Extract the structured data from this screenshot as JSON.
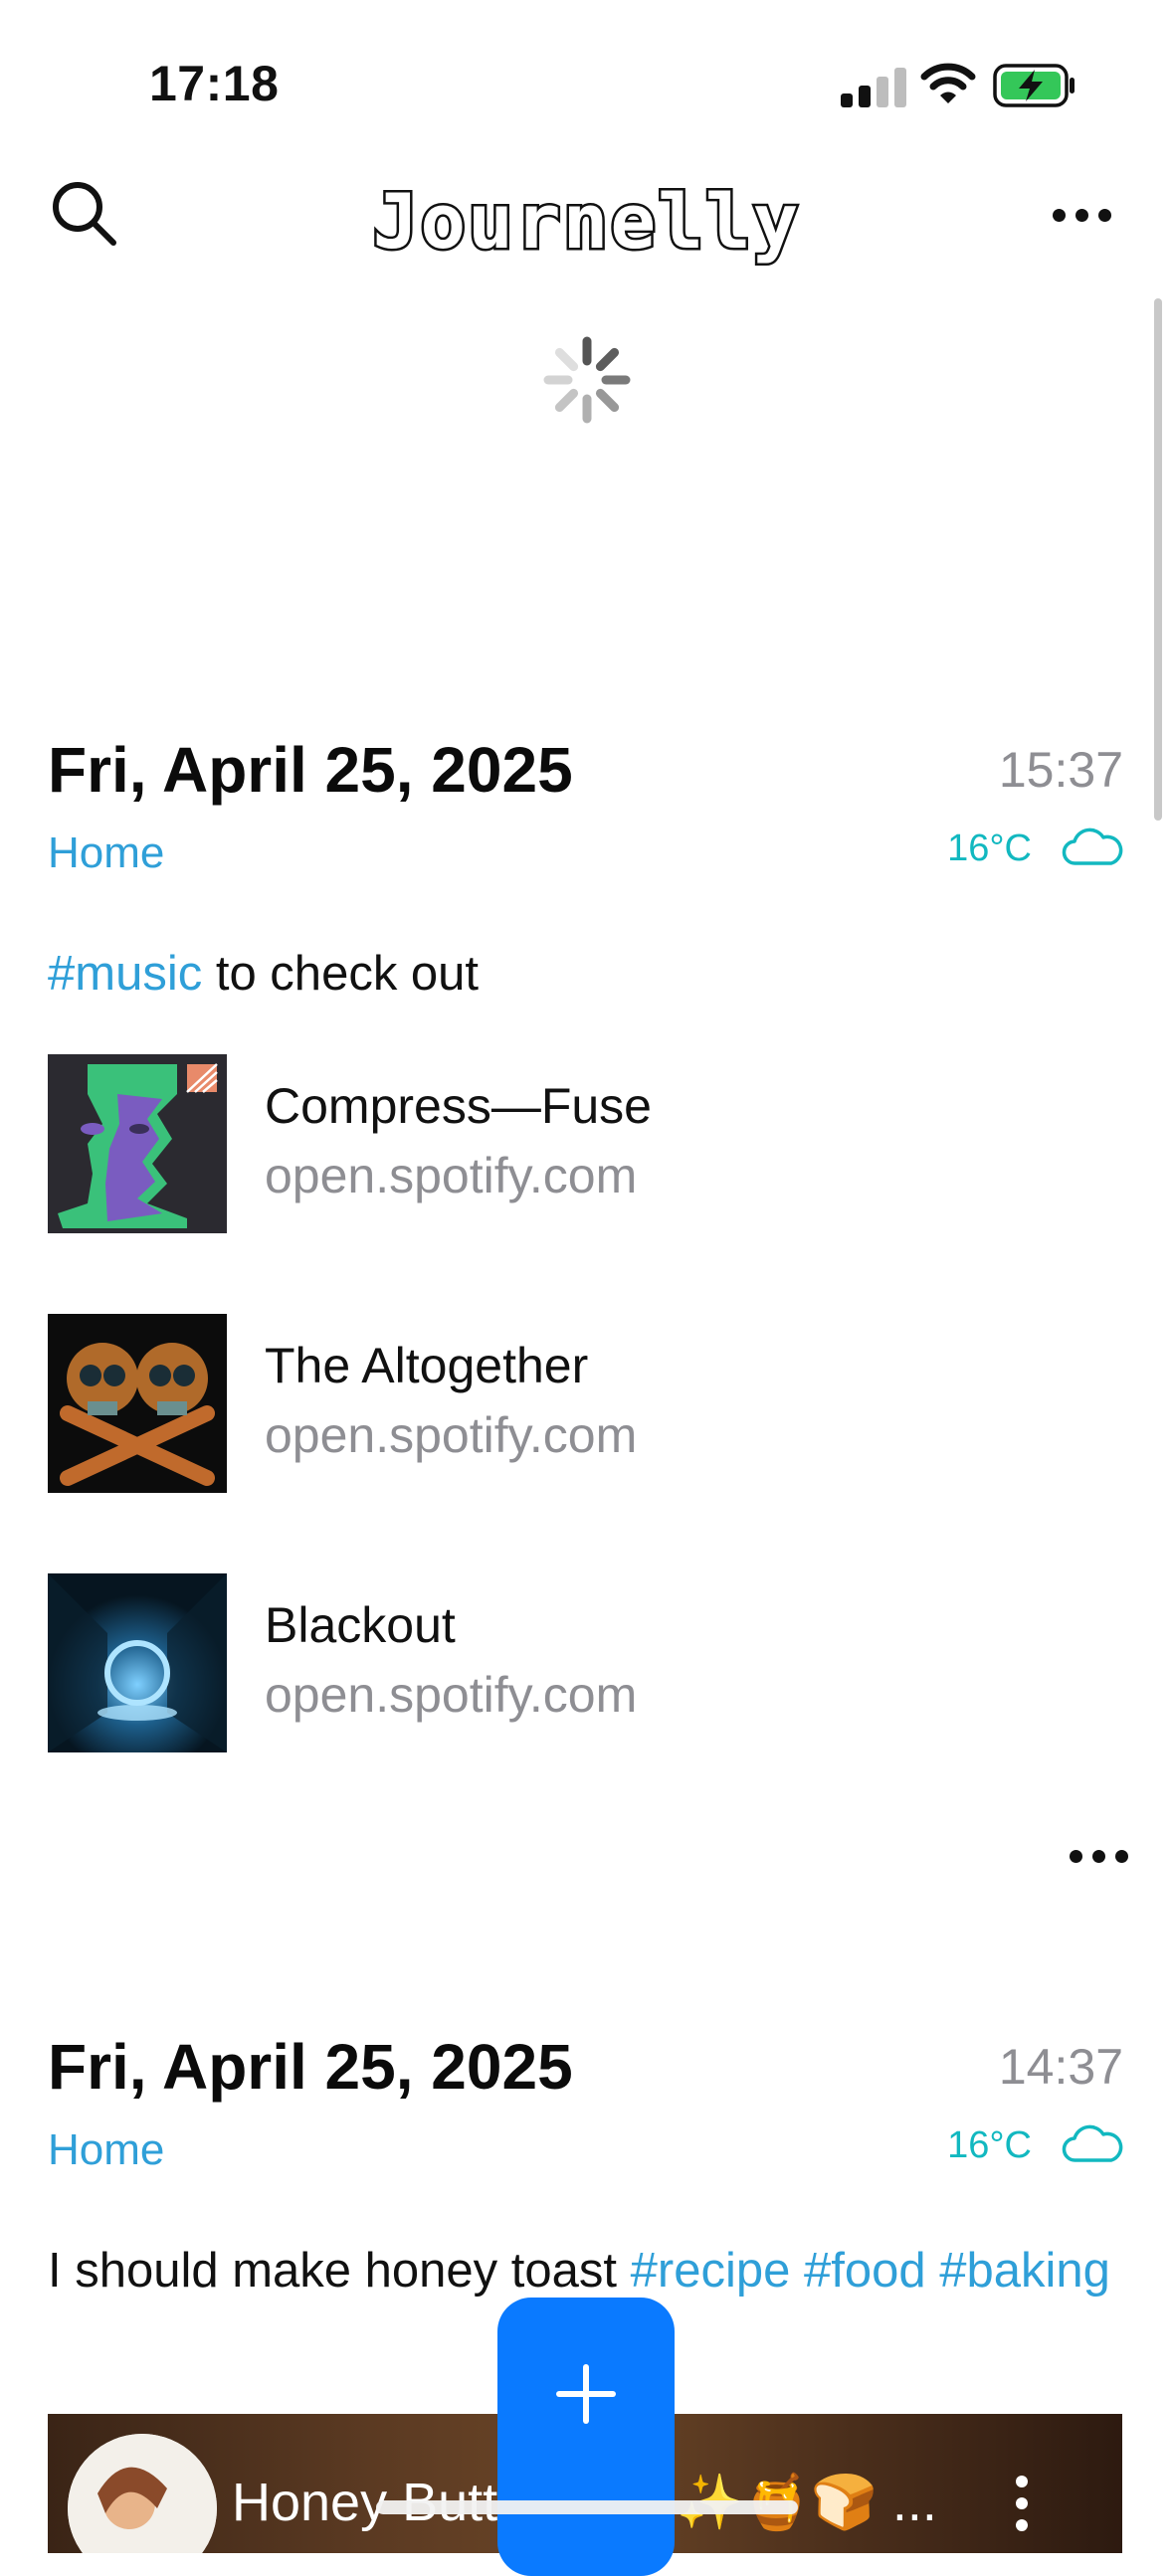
{
  "status_bar": {
    "time": "17:18",
    "signal_icon": "cellular-signal-icon",
    "wifi_icon": "wifi-icon",
    "battery_icon": "battery-charging-icon",
    "battery_color": "#34c759"
  },
  "header": {
    "title": "Journelly",
    "search_icon": "search-icon",
    "menu_icon": "more-horizontal-icon"
  },
  "loading_icon": "activity-spinner-icon",
  "colors": {
    "accent": "#2f9fd8",
    "weather": "#12b8c0",
    "fab": "#0a7aff",
    "secondary_text": "#8e8e93"
  },
  "entries": [
    {
      "date": "Fri, April 25, 2025",
      "time": "15:37",
      "location": "Home",
      "temperature": "16°C",
      "weather_icon": "cloud-icon",
      "text_tag": "#music",
      "text_rest": " to check out",
      "links": [
        {
          "title": "Compress—Fuse",
          "host": "open.spotify.com",
          "thumb_icon": "album-art-face-icon"
        },
        {
          "title": "The Altogether",
          "host": "open.spotify.com",
          "thumb_icon": "album-art-skulls-icon"
        },
        {
          "title": "Blackout",
          "host": "open.spotify.com",
          "thumb_icon": "album-art-portal-icon"
        }
      ],
      "more_icon": "more-horizontal-icon"
    },
    {
      "date": "Fri, April 25, 2025",
      "time": "14:37",
      "location": "Home",
      "temperature": "16°C",
      "weather_icon": "cloud-icon",
      "text_plain": "I should make honey toast ",
      "tags": [
        "#recipe",
        "#food",
        "#baking"
      ],
      "video": {
        "title": "Honey Butt",
        "title_tail": "t ✨🍯🍞 ..."
      }
    }
  ],
  "fab": {
    "label": "+",
    "icon": "plus-icon"
  }
}
